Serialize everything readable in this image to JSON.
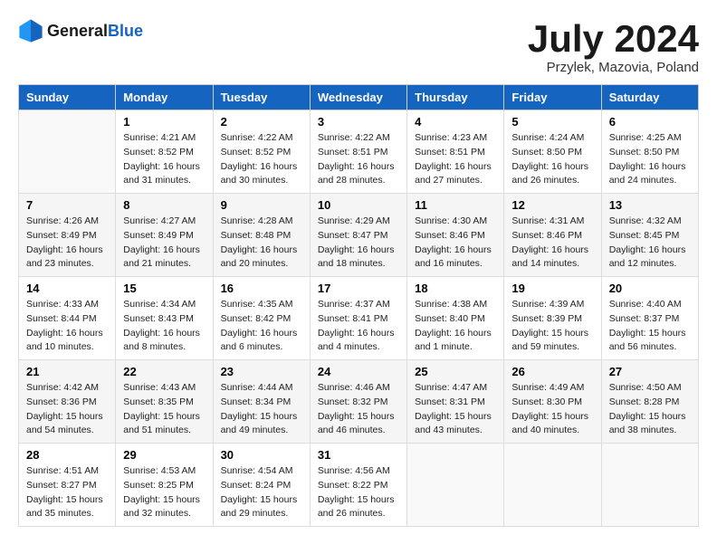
{
  "header": {
    "logo_general": "General",
    "logo_blue": "Blue",
    "title": "July 2024",
    "location": "Przylek, Mazovia, Poland"
  },
  "calendar": {
    "weekdays": [
      "Sunday",
      "Monday",
      "Tuesday",
      "Wednesday",
      "Thursday",
      "Friday",
      "Saturday"
    ],
    "weeks": [
      [
        {
          "day": "",
          "info": ""
        },
        {
          "day": "1",
          "info": "Sunrise: 4:21 AM\nSunset: 8:52 PM\nDaylight: 16 hours\nand 31 minutes."
        },
        {
          "day": "2",
          "info": "Sunrise: 4:22 AM\nSunset: 8:52 PM\nDaylight: 16 hours\nand 30 minutes."
        },
        {
          "day": "3",
          "info": "Sunrise: 4:22 AM\nSunset: 8:51 PM\nDaylight: 16 hours\nand 28 minutes."
        },
        {
          "day": "4",
          "info": "Sunrise: 4:23 AM\nSunset: 8:51 PM\nDaylight: 16 hours\nand 27 minutes."
        },
        {
          "day": "5",
          "info": "Sunrise: 4:24 AM\nSunset: 8:50 PM\nDaylight: 16 hours\nand 26 minutes."
        },
        {
          "day": "6",
          "info": "Sunrise: 4:25 AM\nSunset: 8:50 PM\nDaylight: 16 hours\nand 24 minutes."
        }
      ],
      [
        {
          "day": "7",
          "info": "Sunrise: 4:26 AM\nSunset: 8:49 PM\nDaylight: 16 hours\nand 23 minutes."
        },
        {
          "day": "8",
          "info": "Sunrise: 4:27 AM\nSunset: 8:49 PM\nDaylight: 16 hours\nand 21 minutes."
        },
        {
          "day": "9",
          "info": "Sunrise: 4:28 AM\nSunset: 8:48 PM\nDaylight: 16 hours\nand 20 minutes."
        },
        {
          "day": "10",
          "info": "Sunrise: 4:29 AM\nSunset: 8:47 PM\nDaylight: 16 hours\nand 18 minutes."
        },
        {
          "day": "11",
          "info": "Sunrise: 4:30 AM\nSunset: 8:46 PM\nDaylight: 16 hours\nand 16 minutes."
        },
        {
          "day": "12",
          "info": "Sunrise: 4:31 AM\nSunset: 8:46 PM\nDaylight: 16 hours\nand 14 minutes."
        },
        {
          "day": "13",
          "info": "Sunrise: 4:32 AM\nSunset: 8:45 PM\nDaylight: 16 hours\nand 12 minutes."
        }
      ],
      [
        {
          "day": "14",
          "info": "Sunrise: 4:33 AM\nSunset: 8:44 PM\nDaylight: 16 hours\nand 10 minutes."
        },
        {
          "day": "15",
          "info": "Sunrise: 4:34 AM\nSunset: 8:43 PM\nDaylight: 16 hours\nand 8 minutes."
        },
        {
          "day": "16",
          "info": "Sunrise: 4:35 AM\nSunset: 8:42 PM\nDaylight: 16 hours\nand 6 minutes."
        },
        {
          "day": "17",
          "info": "Sunrise: 4:37 AM\nSunset: 8:41 PM\nDaylight: 16 hours\nand 4 minutes."
        },
        {
          "day": "18",
          "info": "Sunrise: 4:38 AM\nSunset: 8:40 PM\nDaylight: 16 hours\nand 1 minute."
        },
        {
          "day": "19",
          "info": "Sunrise: 4:39 AM\nSunset: 8:39 PM\nDaylight: 15 hours\nand 59 minutes."
        },
        {
          "day": "20",
          "info": "Sunrise: 4:40 AM\nSunset: 8:37 PM\nDaylight: 15 hours\nand 56 minutes."
        }
      ],
      [
        {
          "day": "21",
          "info": "Sunrise: 4:42 AM\nSunset: 8:36 PM\nDaylight: 15 hours\nand 54 minutes."
        },
        {
          "day": "22",
          "info": "Sunrise: 4:43 AM\nSunset: 8:35 PM\nDaylight: 15 hours\nand 51 minutes."
        },
        {
          "day": "23",
          "info": "Sunrise: 4:44 AM\nSunset: 8:34 PM\nDaylight: 15 hours\nand 49 minutes."
        },
        {
          "day": "24",
          "info": "Sunrise: 4:46 AM\nSunset: 8:32 PM\nDaylight: 15 hours\nand 46 minutes."
        },
        {
          "day": "25",
          "info": "Sunrise: 4:47 AM\nSunset: 8:31 PM\nDaylight: 15 hours\nand 43 minutes."
        },
        {
          "day": "26",
          "info": "Sunrise: 4:49 AM\nSunset: 8:30 PM\nDaylight: 15 hours\nand 40 minutes."
        },
        {
          "day": "27",
          "info": "Sunrise: 4:50 AM\nSunset: 8:28 PM\nDaylight: 15 hours\nand 38 minutes."
        }
      ],
      [
        {
          "day": "28",
          "info": "Sunrise: 4:51 AM\nSunset: 8:27 PM\nDaylight: 15 hours\nand 35 minutes."
        },
        {
          "day": "29",
          "info": "Sunrise: 4:53 AM\nSunset: 8:25 PM\nDaylight: 15 hours\nand 32 minutes."
        },
        {
          "day": "30",
          "info": "Sunrise: 4:54 AM\nSunset: 8:24 PM\nDaylight: 15 hours\nand 29 minutes."
        },
        {
          "day": "31",
          "info": "Sunrise: 4:56 AM\nSunset: 8:22 PM\nDaylight: 15 hours\nand 26 minutes."
        },
        {
          "day": "",
          "info": ""
        },
        {
          "day": "",
          "info": ""
        },
        {
          "day": "",
          "info": ""
        }
      ]
    ]
  }
}
